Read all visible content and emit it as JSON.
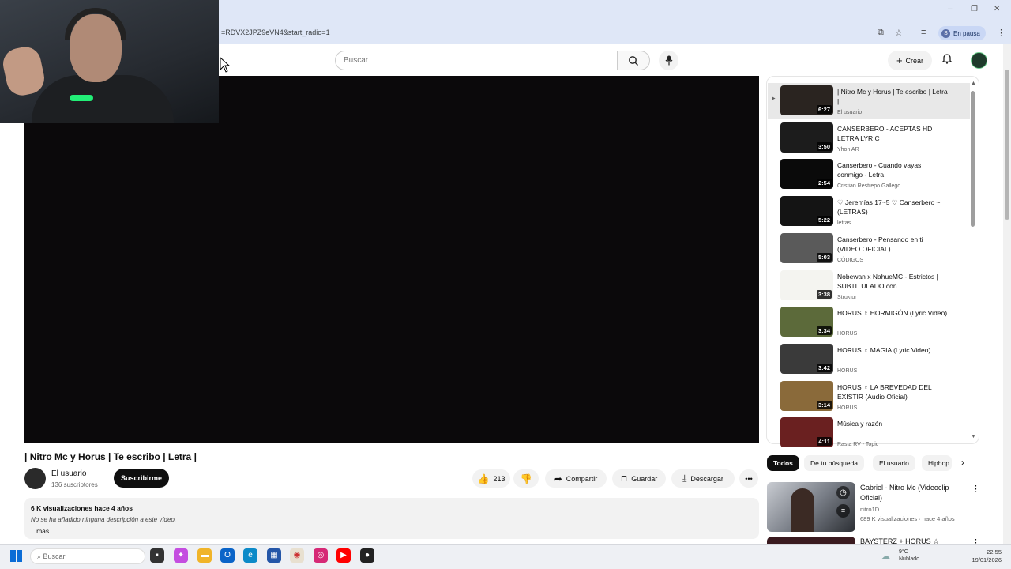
{
  "browser": {
    "url": "=RDVX2JPZ9eVN4&start_radio=1",
    "profile_initial": "S",
    "profile_status": "En pausa",
    "win_min": "–",
    "win_max": "❐",
    "win_close": "✕"
  },
  "header": {
    "search_placeholder": "Buscar",
    "create_label": "Crear"
  },
  "video": {
    "title": "| Nitro Mc y Horus | Te escribo | Letra |",
    "channel": "El usuario",
    "subscribers": "136 suscriptores",
    "subscribe_label": "Suscribirme",
    "likes": "213",
    "share_label": "Compartir",
    "save_label": "Guardar",
    "download_label": "Descargar",
    "views_date": "6 K visualizaciones  hace 4 años",
    "description": "No se ha añadido ninguna descripción a este vídeo.",
    "more_label": "...más"
  },
  "playlist": {
    "items": [
      {
        "title": "| Nitro Mc y Horus | Te escribo | Letra |",
        "channel": "El usuario",
        "duration": "6:27",
        "thumb": "#2a2420"
      },
      {
        "title": "CANSERBERO - ACEPTAS HD LETRA LYRIC",
        "channel": "Yhon AR",
        "duration": "3:50",
        "thumb": "#1c1c1c"
      },
      {
        "title": "Canserbero - Cuando vayas conmigo - Letra",
        "channel": "Cristian Restrepo Gallego",
        "duration": "2:54",
        "thumb": "#0a0a0a"
      },
      {
        "title": "♡ Jeremías 17~5 ♡ Canserbero ~ (LETRAS)",
        "channel": "letras",
        "duration": "5:22",
        "thumb": "#141414"
      },
      {
        "title": "Canserbero - Pensando en ti (VIDEO OFICIAL)",
        "channel": "CÓDIGOS",
        "duration": "5:03",
        "thumb": "#5a5a5a"
      },
      {
        "title": "Nobewan x NahueMC - Estrictos | SUBTITULADO con...",
        "channel": "Struktur !",
        "duration": "3:38",
        "thumb": "#f4f4f0"
      },
      {
        "title": "HORUS ♀ HORMIGÓN (Lyric Video)",
        "channel": "HORUS",
        "duration": "3:34",
        "thumb": "#5c6a3a"
      },
      {
        "title": "HORUS ♀ MAGIA (Lyric Video)",
        "channel": "HORUS",
        "duration": "3:42",
        "thumb": "#3a3a3a"
      },
      {
        "title": "HORUS ♀ LA BREVEDAD DEL EXISTIR (Audio Oficial)",
        "channel": "HORUS",
        "duration": "3:14",
        "thumb": "#8a6a3a"
      },
      {
        "title": "Música y razón",
        "channel": "Rasta RV - Topic",
        "duration": "4:11",
        "thumb": "#6a2020"
      }
    ]
  },
  "chips": [
    "Todos",
    "De tu búsqueda",
    "El usuario",
    "Hiphop"
  ],
  "recommendation": {
    "title": "Gabriel - Nitro Mc (Videoclip Oficial)",
    "channel": "nitro1D",
    "meta": "689 K visualizaciones · hace 4 años",
    "next_title": "BAYSTERZ + HORUS ☆"
  },
  "taskbar": {
    "search_placeholder": "Buscar",
    "weather_temp": "9°C",
    "weather_desc": "Nublado",
    "time": "22:55",
    "date": "19/01/2026"
  },
  "colors": {
    "youtube_red": "#ff0000",
    "chrome_bg": "#dfe7f7",
    "player_bg": "#0b090b"
  }
}
